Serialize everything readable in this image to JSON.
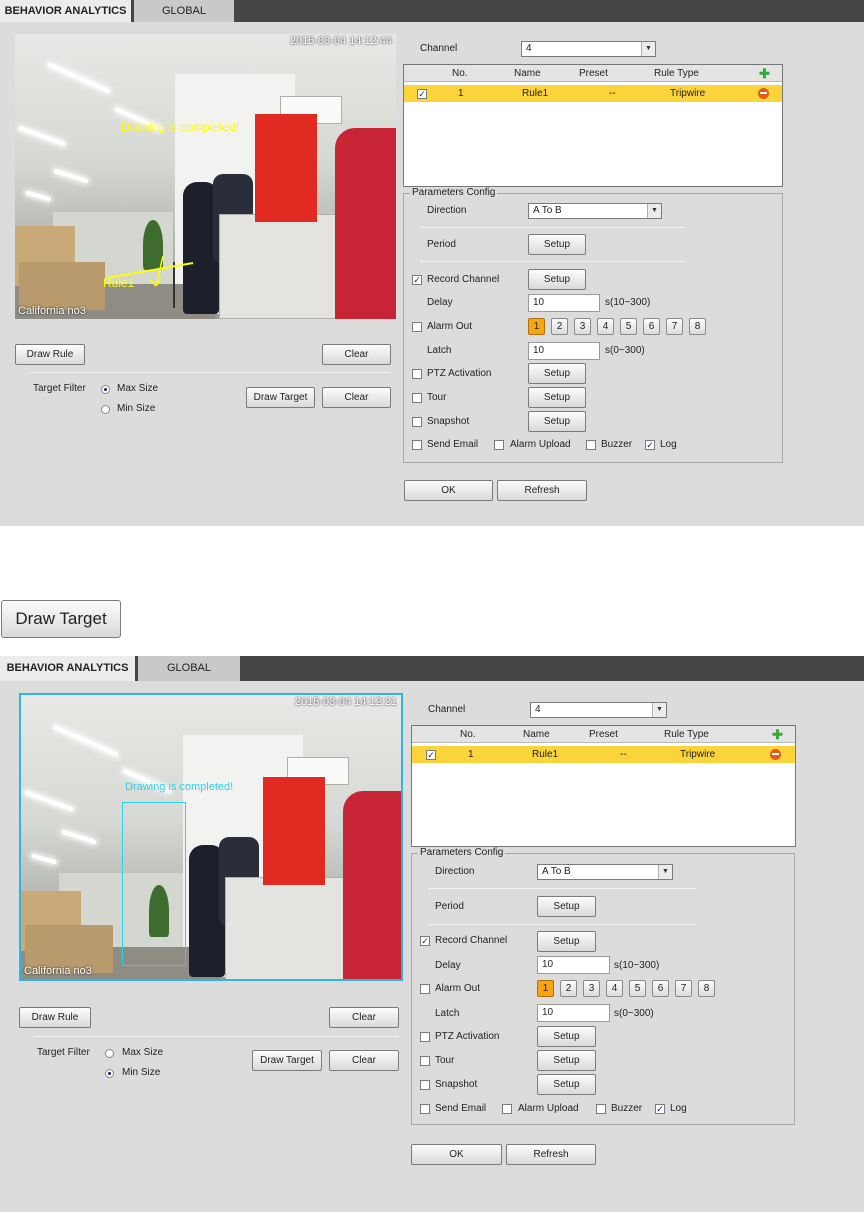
{
  "panels": [
    {
      "tabs": [
        "BEHAVIOR ANALYTICS",
        "GLOBAL"
      ],
      "video": {
        "timestamp": "2015-03-04 14:12:44",
        "channel_name": "California  no3",
        "message": "Drawing is completed!",
        "message_color": "#ffff00",
        "rule_label": "Rule1"
      },
      "buttons": {
        "draw_rule": "Draw Rule",
        "clear1": "Clear",
        "draw_target": "Draw Target",
        "clear2": "Clear",
        "ok": "OK",
        "refresh": "Refresh"
      },
      "target_filter": {
        "label": "Target Filter",
        "max": "Max Size",
        "min": "Min Size",
        "selected": "Max Size"
      },
      "channel": {
        "label": "Channel",
        "value": "4"
      },
      "rule_table": {
        "headers": [
          "No.",
          "Name",
          "Preset",
          "Rule Type"
        ],
        "rows": [
          {
            "checked": true,
            "no": "1",
            "name": "Rule1",
            "preset": "--",
            "type": "Tripwire"
          }
        ]
      },
      "params": {
        "title": "Parameters Config",
        "direction_label": "Direction",
        "direction_value": "A To B",
        "period_label": "Period",
        "setup": "Setup",
        "record_channel": "Record Channel",
        "record_checked": true,
        "delay_label": "Delay",
        "delay_value": "10",
        "delay_range": "s(10~300)",
        "alarm_out": "Alarm Out",
        "alarm_numbers": [
          "1",
          "2",
          "3",
          "4",
          "5",
          "6",
          "7",
          "8"
        ],
        "latch_label": "Latch",
        "latch_value": "10",
        "latch_range": "s(0~300)",
        "ptz": "PTZ Activation",
        "tour": "Tour",
        "snapshot": "Snapshot",
        "send_email": "Send Email",
        "alarm_upload": "Alarm Upload",
        "buzzer": "Buzzer",
        "log": "Log"
      }
    },
    {
      "tabs": [
        "BEHAVIOR ANALYTICS",
        "GLOBAL"
      ],
      "video": {
        "timestamp": "2015-03-04 14:12:21",
        "channel_name": "California  no3",
        "message": "Drawing is completed!",
        "message_color": "#2ad2f0"
      },
      "buttons": {
        "draw_rule": "Draw Rule",
        "clear1": "Clear",
        "draw_target": "Draw Target",
        "clear2": "Clear",
        "ok": "OK",
        "refresh": "Refresh"
      },
      "target_filter": {
        "label": "Target Filter",
        "max": "Max Size",
        "min": "Min Size",
        "selected": "Min Size"
      },
      "channel": {
        "label": "Channel",
        "value": "4"
      },
      "rule_table": {
        "headers": [
          "No.",
          "Name",
          "Preset",
          "Rule Type"
        ],
        "rows": [
          {
            "checked": true,
            "no": "1",
            "name": "Rule1",
            "preset": "--",
            "type": "Tripwire"
          }
        ]
      },
      "params": {
        "title": "Parameters Config",
        "direction_label": "Direction",
        "direction_value": "A To B",
        "period_label": "Period",
        "setup": "Setup",
        "record_channel": "Record Channel",
        "record_checked": true,
        "delay_label": "Delay",
        "delay_value": "10",
        "delay_range": "s(10~300)",
        "alarm_out": "Alarm Out",
        "alarm_numbers": [
          "1",
          "2",
          "3",
          "4",
          "5",
          "6",
          "7",
          "8"
        ],
        "latch_label": "Latch",
        "latch_value": "10",
        "latch_range": "s(0~300)",
        "ptz": "PTZ Activation",
        "tour": "Tour",
        "snapshot": "Snapshot",
        "send_email": "Send Email",
        "alarm_upload": "Alarm Upload",
        "buzzer": "Buzzer",
        "log": "Log"
      }
    }
  ],
  "callout_button": "Draw Target",
  "icons": [
    "add-icon",
    "delete-icon",
    "dropdown-arrow-icon",
    "check-icon"
  ]
}
